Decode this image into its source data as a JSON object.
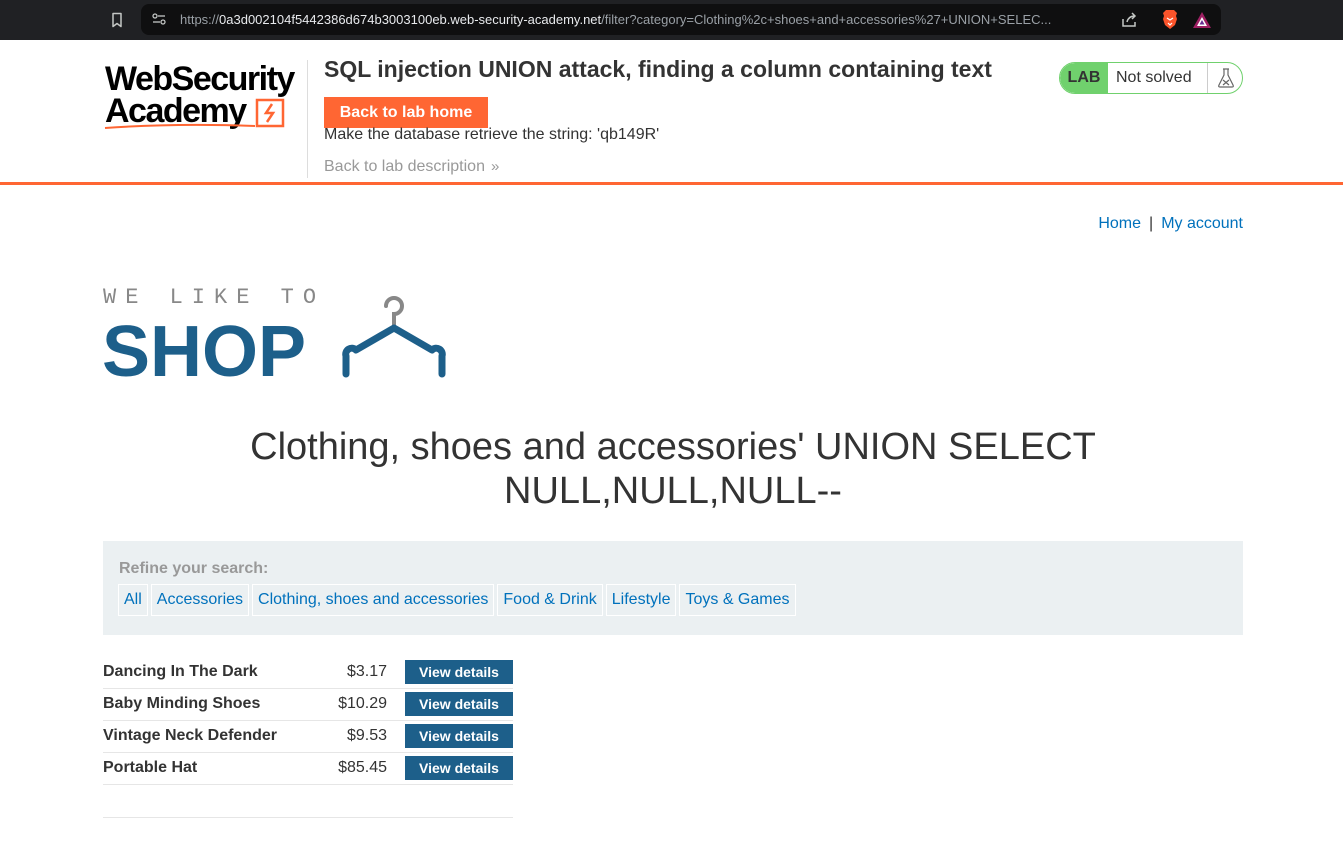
{
  "browser": {
    "url_scheme": "https://",
    "url_host": "0a3d002104f5442386d674b3003100eb.web-security-academy.net",
    "url_path": "/filter?category=Clothing%2c+shoes+and+accessories%27+UNION+SELEC..."
  },
  "academy": {
    "logo_line1": "WebSecurity",
    "logo_line2": "Academy",
    "lab_title": "SQL injection UNION attack, finding a column containing text",
    "back_home_label": "Back to lab home",
    "instruction": "Make the database retrieve the string: 'qb149R'",
    "back_desc_label": "Back to lab description",
    "lab_badge": "LAB",
    "lab_status": "Not solved"
  },
  "nav": {
    "home": "Home",
    "separator": "|",
    "account": "My account"
  },
  "shop_logo": {
    "tagline": "WE LIKE TO",
    "word": "SHOP"
  },
  "category_heading": "Clothing, shoes and accessories' UNION SELECT NULL,NULL,NULL--",
  "refine": {
    "label": "Refine your search:",
    "filters": [
      "All",
      "Accessories",
      "Clothing, shoes and accessories",
      "Food & Drink",
      "Lifestyle",
      "Toys & Games"
    ]
  },
  "products": [
    {
      "name": "Dancing In The Dark",
      "price": "$3.17",
      "action": "View details"
    },
    {
      "name": "Baby Minding Shoes",
      "price": "$10.29",
      "action": "View details"
    },
    {
      "name": "Vintage Neck Defender",
      "price": "$9.53",
      "action": "View details"
    },
    {
      "name": "Portable Hat",
      "price": "$85.45",
      "action": "View details"
    }
  ],
  "colors": {
    "accent_orange": "#ff6633",
    "link_blue": "#0071bc",
    "shop_blue": "#1d5f8a",
    "lab_green": "#70d16d"
  },
  "icons": [
    "bookmark-icon",
    "site-info-icon",
    "share-icon",
    "brave-lion-icon",
    "brave-rewards-icon",
    "flask-icon",
    "hanger-icon",
    "chevron-right-icon"
  ]
}
